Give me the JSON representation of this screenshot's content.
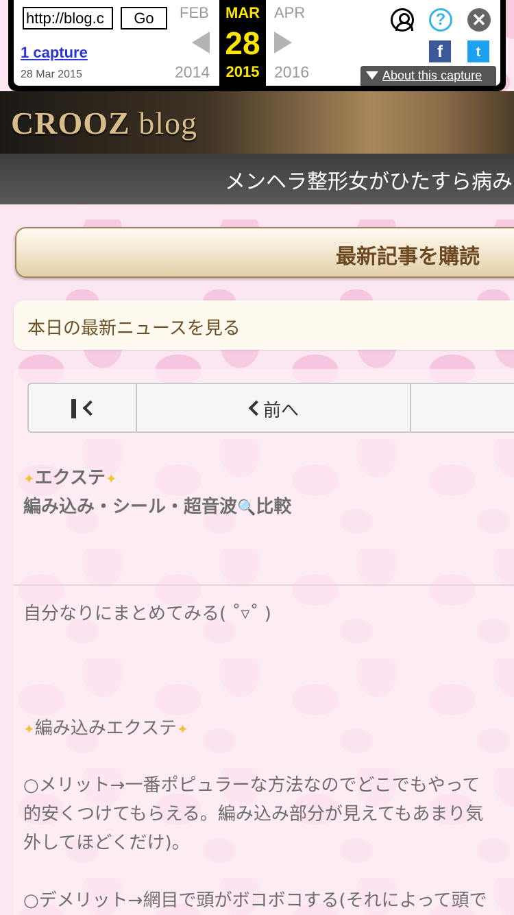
{
  "wayback": {
    "url_value": "http://blog.c",
    "go_label": "Go",
    "captures": "1 capture",
    "capture_date": "28 Mar 2015",
    "prev_month": "FEB",
    "current_month": "MAR",
    "next_month": "APR",
    "current_day": "28",
    "prev_year": "2014",
    "current_year": "2015",
    "next_year": "2016",
    "help_glyph": "?",
    "close_glyph": "✕",
    "facebook_glyph": "f",
    "twitter_glyph": "t",
    "about_label": "About this capture"
  },
  "blog": {
    "logo_main": "CROOZ",
    "logo_sub": "blog",
    "title": "メンヘラ整形女がひたすら病み"
  },
  "actions": {
    "subscribe_label": "最新記事を購読",
    "news_label": "本日の最新ニュースを見る"
  },
  "pager": {
    "prev_label": "前へ"
  },
  "post": {
    "sparkle_glyph": "✦",
    "title_line1": "エクステ",
    "title_line2_a": "編み込み・シール・超音波",
    "magnifier_glyph": "🔍",
    "title_line2_b": "比較",
    "intro": "自分なりにまとめてみる( ˚▿˚ )",
    "section_title": "編み込みエクステ",
    "merit_line1": "○メリット→一番ポピュラーな方法なのでどこでもやって",
    "merit_line2": "的安くつけてもらえる。編み込み部分が見えてもあまり気",
    "merit_line3": "外してほどくだけ)。",
    "demerit_line1": "○デメリット→網目で頭がボコボコする(それによって頭で"
  },
  "colors": {
    "accent_yellow": "#ffe600",
    "link_blue": "#2a35d9",
    "help_blue": "#37b4e6",
    "facebook": "#3b5998",
    "twitter": "#1da1f2",
    "header_gold": "#a8875a",
    "subscribe_text": "#6b4820",
    "body_text": "#6e6e6e",
    "background_pink": "#fbe6f1"
  },
  "icons": {
    "user": "user-circle-icon",
    "help": "help-icon",
    "close": "close-icon",
    "facebook": "facebook-icon",
    "twitter": "twitter-icon",
    "first_page": "first-page-icon",
    "prev_page": "chevron-left-icon"
  }
}
